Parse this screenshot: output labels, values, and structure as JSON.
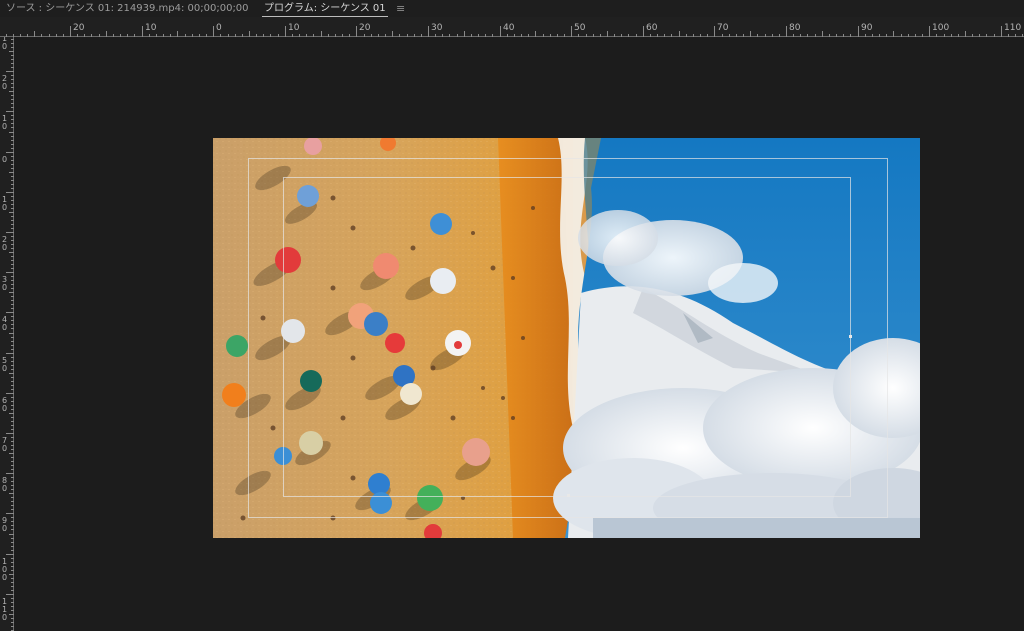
{
  "tabs": {
    "source_label": "ソース : シーケンス 01: 214939.mp4: 00;00;00;00",
    "program_label": "プログラム: シーケンス 01",
    "menu_icon": "hamburger-menu-icon"
  },
  "ruler": {
    "horizontal_labels": [
      "20",
      "10",
      "0",
      "10",
      "20",
      "30",
      "40",
      "50",
      "60",
      "70",
      "80",
      "90",
      "100",
      "110"
    ],
    "vertical_labels": [
      "1\n0",
      "2\n0",
      "1\n0",
      "0",
      "1\n0",
      "2\n0",
      "3\n0",
      "4\n0",
      "5\n0",
      "6\n0",
      "7\n0",
      "8\n0",
      "9\n0",
      "1\n0\n0",
      "1\n1\n0"
    ]
  },
  "preview": {
    "description_icon": "video-frame-preview",
    "left_scene": "beach-umbrellas",
    "right_scene": "snowy-mountain-clouds"
  },
  "colors": {
    "panel_bg": "#1c1c1c",
    "ruler_bg": "#202020",
    "sand": "#d99a4a",
    "sea": "#e08a1e",
    "sky": "#1f7fc4",
    "cloud": "#f2f4f7"
  }
}
